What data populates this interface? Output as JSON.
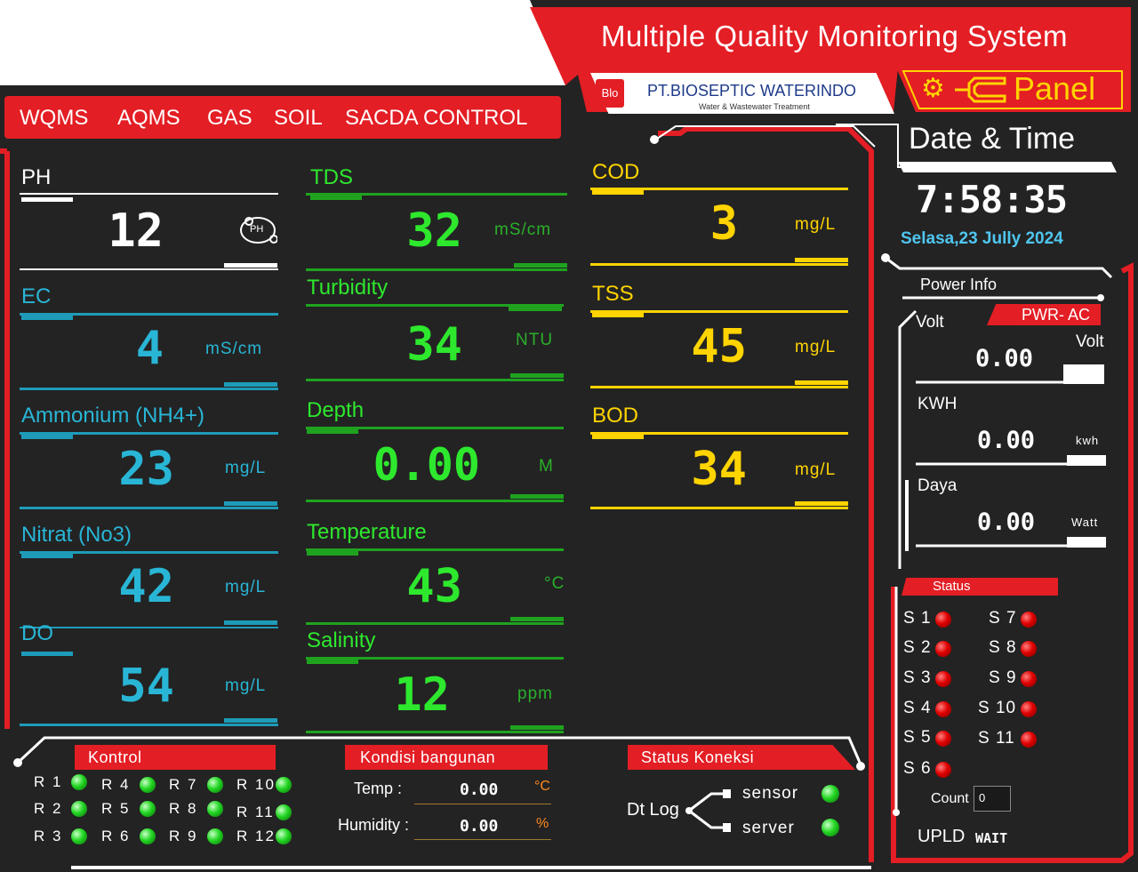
{
  "header": {
    "title": "Multiple Quality Monitoring System",
    "company_logo": "Blo",
    "company_name": "PT.BIOSEPTIC WATERINDO",
    "company_sub": "Water & Wastewater Treatment",
    "panel_label": "Panel",
    "panel_icon": "gear-icon"
  },
  "nav": [
    "WQMS",
    "AQMS",
    "GAS",
    "SOIL",
    "SACDA CONTROL"
  ],
  "datetime": {
    "title": "Date & Time",
    "time": "7:58:35",
    "date": "Selasa,23 Jully 2024"
  },
  "sensors": {
    "ph": {
      "name": "PH",
      "value": "12",
      "icon": "ph-sensor-icon",
      "icon_text": "PH"
    },
    "ec": {
      "name": "EC",
      "value": "4",
      "unit": "mS/cm"
    },
    "ammonium": {
      "name": "Ammonium (NH4+)",
      "value": "23",
      "unit": "mg/L"
    },
    "nitrat": {
      "name": "Nitrat (No3)",
      "value": "42",
      "unit": "mg/L"
    },
    "do": {
      "name": "DO",
      "value": "54",
      "unit": "mg/L"
    },
    "tds": {
      "name": "TDS",
      "value": "32",
      "unit": "mS/cm"
    },
    "turbidity": {
      "name": "Turbidity",
      "value": "34",
      "unit": "NTU"
    },
    "depth": {
      "name": "Depth",
      "value": "0.00",
      "unit": "M"
    },
    "temperature": {
      "name": "Temperature",
      "value": "43",
      "unit": "°C"
    },
    "salinity": {
      "name": "Salinity",
      "value": "12",
      "unit": "ppm"
    },
    "cod": {
      "name": "COD",
      "value": "3",
      "unit": "mg/L"
    },
    "tss": {
      "name": "TSS",
      "value": "45",
      "unit": "mg/L"
    },
    "bod": {
      "name": "BOD",
      "value": "34",
      "unit": "mg/L"
    }
  },
  "power": {
    "title": "Power Info",
    "badge": "PWR- AC",
    "volt_label": "Volt",
    "volt_value": "0.00",
    "volt_unit": "Volt",
    "kwh_label": "KWH",
    "kwh_value": "0.00",
    "kwh_unit": "kwh",
    "daya_label": "Daya",
    "daya_value": "0.00",
    "daya_unit": "Watt"
  },
  "status": {
    "title": "Status",
    "left": [
      "S 1",
      "S 2",
      "S 3",
      "S 4",
      "S 5",
      "S 6"
    ],
    "right": [
      "S 7",
      "S 8",
      "S 9",
      "S 10",
      "S 11"
    ],
    "count_label": "Count",
    "count_value": "0",
    "upld_label": "UPLD",
    "upld_value": "WAIT"
  },
  "kontrol": {
    "title": "Kontrol",
    "relays": [
      "R 1",
      "R 2",
      "R 3",
      "R 4",
      "R 5",
      "R 6",
      "R 7",
      "R 8",
      "R 9",
      "R 10",
      "R 11",
      "R 12"
    ]
  },
  "kondisi": {
    "title": "Kondisi bangunan",
    "temp_label": "Temp :",
    "temp_value": "0.00",
    "temp_unit": "°C",
    "hum_label": "Humidity :",
    "hum_value": "0.00",
    "hum_unit": "%"
  },
  "koneksi": {
    "title": "Status Koneksi",
    "dtlog": "Dt Log",
    "sensor": "sensor",
    "server": "server"
  },
  "colors": {
    "accent_red": "#e31e24",
    "green": "#2ee82e",
    "cyan": "#29b6d6",
    "yellow": "#ffd400",
    "bg": "#232323"
  }
}
